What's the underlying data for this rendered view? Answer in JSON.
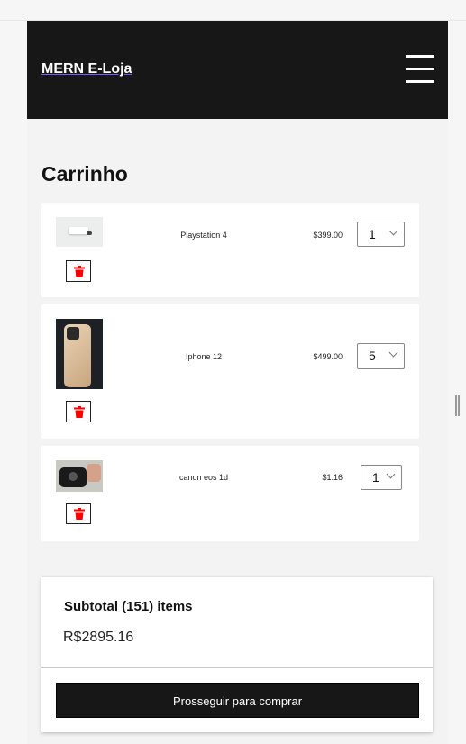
{
  "brand": "MERN E-Loja",
  "icons": {
    "menu": "hamburger-menu-icon",
    "delete": "trash-icon",
    "dropdown": "chevron-down-icon"
  },
  "colors": {
    "navbar": "#171717",
    "delete_icon": "#ff0000",
    "button": "#171717"
  },
  "cart": {
    "title": "Carrinho",
    "items": [
      {
        "name": "Playstation 4",
        "price": "$399.00",
        "qty": "1"
      },
      {
        "name": "Iphone 12",
        "price": "$499.00",
        "qty": "5"
      },
      {
        "name": "canon eos 1d",
        "price": "$1.16",
        "qty": "1"
      }
    ]
  },
  "summary": {
    "subtotal_label": "Subtotal (151) items",
    "subtotal_value": "R$2895.16",
    "checkout_label": "Prosseguir para comprar"
  }
}
